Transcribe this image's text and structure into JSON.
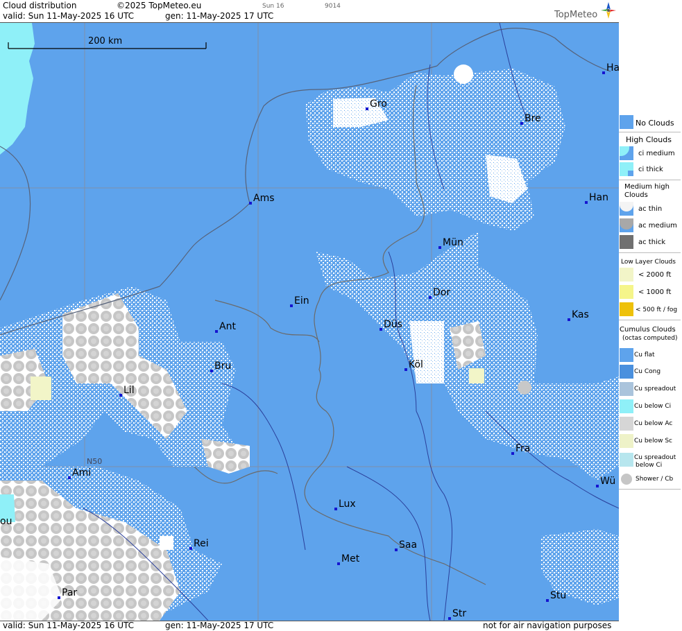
{
  "header": {
    "title": "Cloud distribution",
    "copyright": "©2025 TopMeteo.eu",
    "day_label": "Sun 16",
    "code": "9014",
    "valid": "valid:  Sun  11-May-2025  16 UTC",
    "generated": "gen: 11-May-2025 17 UTC",
    "brand": "TopMeteo"
  },
  "map": {
    "scale_label": "200 km",
    "grid_label": "N50",
    "colors": {
      "no_clouds": "#5ea3ec",
      "cumulus": "#ffffff",
      "shower": "#c8c8c8",
      "high_cloud": "#8ff0f8",
      "low_cloud": "#f2f5c8"
    },
    "cities": [
      {
        "name": "Gro"
      },
      {
        "name": "Bre"
      },
      {
        "name": "Ha"
      },
      {
        "name": "Ams"
      },
      {
        "name": "Han"
      },
      {
        "name": "Mün"
      },
      {
        "name": "Ein"
      },
      {
        "name": "Dor"
      },
      {
        "name": "Ant"
      },
      {
        "name": "Düs"
      },
      {
        "name": "Kas"
      },
      {
        "name": "Bru"
      },
      {
        "name": "Köl"
      },
      {
        "name": "Lil"
      },
      {
        "name": "Fra"
      },
      {
        "name": "Ami"
      },
      {
        "name": "Wü"
      },
      {
        "name": "Lux"
      },
      {
        "name": "ou"
      },
      {
        "name": "Rei"
      },
      {
        "name": "Saa"
      },
      {
        "name": "Met"
      },
      {
        "name": "Par"
      },
      {
        "name": "Stu"
      },
      {
        "name": "Str"
      }
    ]
  },
  "footer": {
    "valid": "valid:  Sun  11-May-2025  16 UTC",
    "generated": "gen: 11-May-2025 17 UTC",
    "disclaimer": "not for air navigation purposes"
  },
  "legend": {
    "no_clouds": "No Clouds",
    "high_header": "High Clouds",
    "ci_medium": "ci medium",
    "ci_thick": "ci thick",
    "medium_header_1": "Medium high",
    "medium_header_2": "Clouds",
    "ac_thin": "ac thin",
    "ac_medium": "ac medium",
    "ac_thick": "ac thick",
    "low_header": "Low Layer Clouds",
    "lt2000": "< 2000 ft",
    "lt1000": "< 1000 ft",
    "lt500": "< 500 ft / fog",
    "cu_header_1": "Cumulus Clouds",
    "cu_header_2": "(octas computed)",
    "cu_flat": "Cu flat",
    "cu_cong": "Cu Cong",
    "cu_spreadout": "Cu spreadout",
    "cu_below_ci": "Cu below Ci",
    "cu_below_ac": "Cu below Ac",
    "cu_below_sc": "Cu below Sc",
    "cu_spread_ci_1": "Cu spreadout",
    "cu_spread_ci_2": "below Ci",
    "shower": "Shower / Cb"
  }
}
